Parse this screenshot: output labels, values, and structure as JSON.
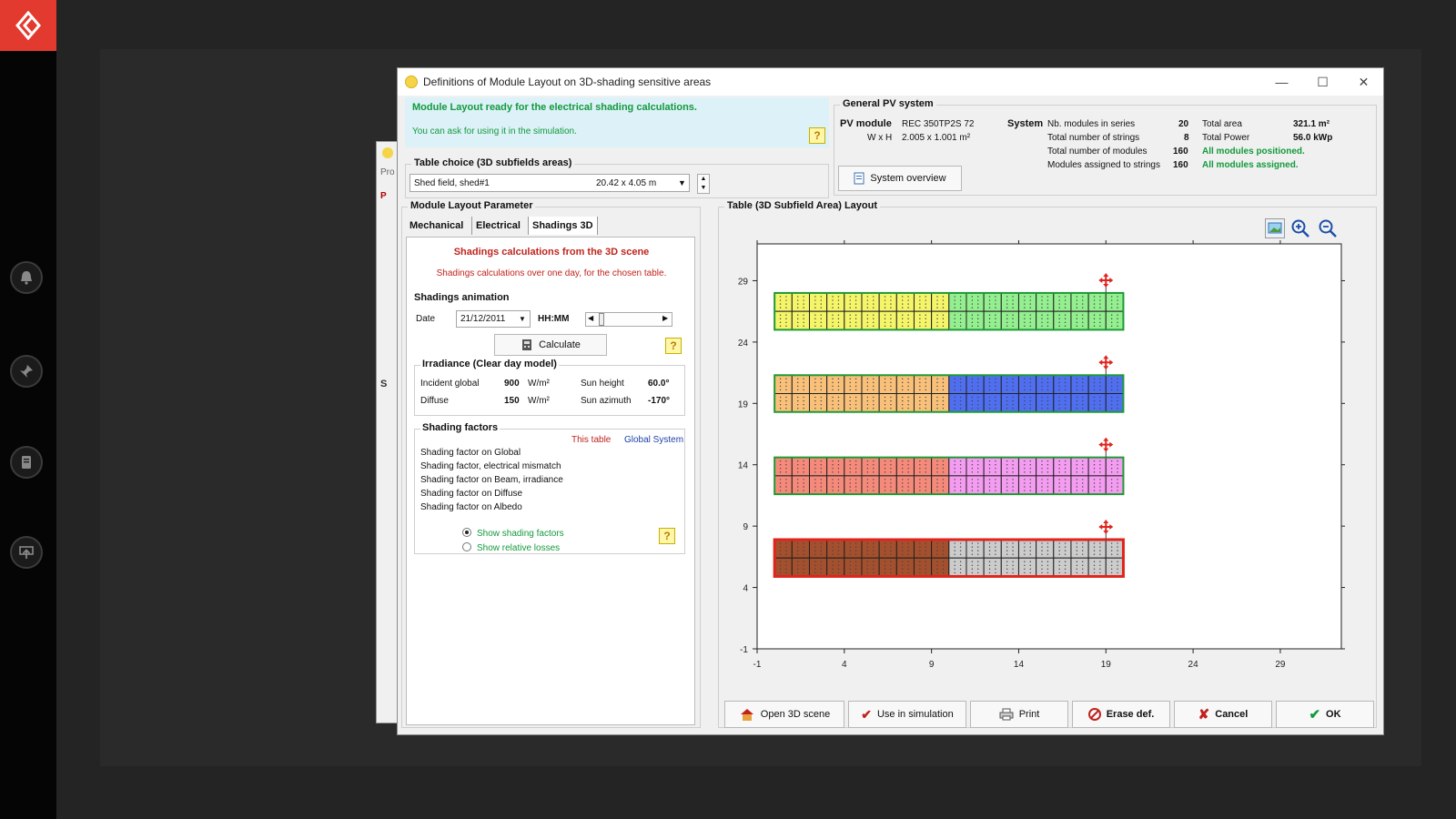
{
  "dialog": {
    "title": "Definitions of Module Layout on 3D-shading sensitive areas",
    "controls": {
      "minimize": "—",
      "maximize": "☐",
      "close": "✕"
    }
  },
  "status": {
    "ready_message": "Module Layout ready for the electrical shading calculations.",
    "hint": "You can ask for using it in the simulation."
  },
  "table_choice": {
    "title": "Table choice  (3D subfields areas)",
    "selected": "Shed field, shed#1",
    "dimensions": "20.42 x   4.05 m"
  },
  "general_pv": {
    "title": "General PV system",
    "pv_module_label": "PV module",
    "pv_module_value": "REC 350TP2S 72",
    "wxh_label": "W x H",
    "wxh_value": "2.005 x 1.001 m²",
    "system_label": "System",
    "rows": [
      {
        "label": "Nb. modules in series",
        "value": "20"
      },
      {
        "label": "Total number of strings",
        "value": "8"
      },
      {
        "label": "Total number of modules",
        "value": "160"
      },
      {
        "label": "Modules assigned to strings",
        "value": "160"
      }
    ],
    "right": [
      {
        "label": "Total area",
        "value": "321.1 m²"
      },
      {
        "label": "Total Power",
        "value": "56.0 kWp"
      },
      {
        "label": "All modules positioned.",
        "value": ""
      },
      {
        "label": "All modules assigned.",
        "value": ""
      }
    ],
    "overview_button": "System overview"
  },
  "params": {
    "title": "Module Layout Parameter",
    "tabs": [
      "Mechanical",
      "Electrical",
      "Shadings 3D"
    ],
    "heading": "Shadings calculations from the 3D scene",
    "subheading": "Shadings calculations over one day, for the chosen table.",
    "animation_title": "Shadings animation",
    "date_label": "Date",
    "date_value": "21/12/2011",
    "hhmm_label": "HH:MM",
    "calculate_button": "Calculate",
    "irradiance_title": "Irradiance (Clear day model)",
    "incident_label": "Incident global",
    "incident_value": "900",
    "diffuse_label": "Diffuse",
    "diffuse_value": "150",
    "unit": "W/m²",
    "sun_height_label": "Sun height",
    "sun_height_value": "60.0°",
    "sun_azimuth_label": "Sun azimuth",
    "sun_azimuth_value": "-170°",
    "shading_title": "Shading factors",
    "this_table": "This table",
    "global_system": "Global System",
    "factors": [
      "Shading factor on Global",
      "Shading factor, electrical mismatch",
      "Shading factor on Beam, irradiance",
      "Shading factor on Diffuse",
      "Shading factor on Albedo"
    ],
    "show_factors": "Show shading factors",
    "show_losses": "Show relative losses"
  },
  "layout_panel": {
    "title": "Table (3D Subfield Area) Layout"
  },
  "buttons": {
    "open3d": "Open 3D scene",
    "use_sim": "Use in simulation",
    "print": "Print",
    "erase": "Erase def.",
    "cancel": "Cancel",
    "ok": "OK"
  },
  "bg_window": {
    "label1": "Pro",
    "label2": "P",
    "label3": "S"
  },
  "colors": {
    "accent_red": "#e23a2e",
    "yellow": "#f5f56a",
    "light_green": "#93ef8f",
    "orange": "#f9c07a",
    "blue": "#4f6ff0",
    "salmon": "#f58a7a",
    "magenta": "#f39cf0",
    "brown": "#a4502e",
    "grey": "#cccccc"
  },
  "chart_data": {
    "type": "heatmap",
    "x_ticks": [
      -1,
      4,
      9,
      14,
      19,
      24,
      29
    ],
    "y_ticks": [
      -1,
      4,
      9,
      14,
      19,
      24,
      29
    ],
    "xlim": [
      -1,
      32.5
    ],
    "ylim": [
      -1,
      32
    ],
    "rows_per_shed": 2,
    "modules_per_row": 20,
    "module_width": 1.0,
    "sheds": [
      {
        "y_bottom": 25.0,
        "left_color": "#f5f56a",
        "right_color": "#93ef8f",
        "split": 10,
        "selected": false
      },
      {
        "y_bottom": 18.3,
        "left_color": "#f9c07a",
        "right_color": "#4f6ff0",
        "split": 10,
        "selected": false
      },
      {
        "y_bottom": 11.6,
        "left_color": "#f58a7a",
        "right_color": "#f39cf0",
        "split": 10,
        "selected": false
      },
      {
        "y_bottom": 4.9,
        "left_color": "#a4502e",
        "right_color": "#cccccc",
        "split": 10,
        "selected": true
      }
    ],
    "x_start": 0.0,
    "shed_height": 3.0
  }
}
